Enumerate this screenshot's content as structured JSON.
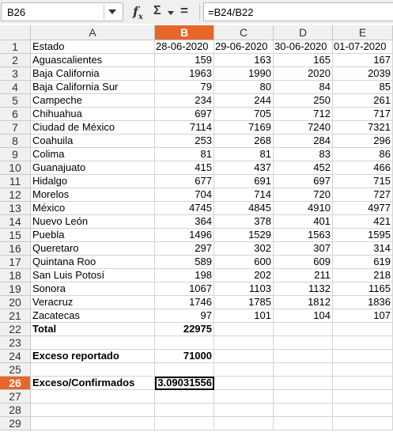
{
  "formula_bar": {
    "name_box": "B26",
    "formula": "=B24/B22"
  },
  "columns": [
    "A",
    "B",
    "C",
    "D",
    "E"
  ],
  "active_column": "B",
  "active_row": 26,
  "rows": [
    {
      "n": "1",
      "a": "Estado",
      "b": "28-06-2020",
      "c": "29-06-2020",
      "d": "30-06-2020",
      "e": "01-07-2020"
    },
    {
      "n": "2",
      "a": "Aguascalientes",
      "b": "159",
      "c": "163",
      "d": "165",
      "e": "167"
    },
    {
      "n": "3",
      "a": "Baja California",
      "b": "1963",
      "c": "1990",
      "d": "2020",
      "e": "2039"
    },
    {
      "n": "4",
      "a": "Baja California Sur",
      "b": "79",
      "c": "80",
      "d": "84",
      "e": "85"
    },
    {
      "n": "5",
      "a": "Campeche",
      "b": "234",
      "c": "244",
      "d": "250",
      "e": "261"
    },
    {
      "n": "6",
      "a": "Chihuahua",
      "b": "697",
      "c": "705",
      "d": "712",
      "e": "717"
    },
    {
      "n": "7",
      "a": "Ciudad de México",
      "b": "7114",
      "c": "7169",
      "d": "7240",
      "e": "7321"
    },
    {
      "n": "8",
      "a": "Coahuila",
      "b": "253",
      "c": "268",
      "d": "284",
      "e": "296"
    },
    {
      "n": "9",
      "a": "Colima",
      "b": "81",
      "c": "81",
      "d": "83",
      "e": "86"
    },
    {
      "n": "10",
      "a": "Guanajuato",
      "b": "415",
      "c": "437",
      "d": "452",
      "e": "466"
    },
    {
      "n": "11",
      "a": "Hidalgo",
      "b": "677",
      "c": "691",
      "d": "697",
      "e": "715"
    },
    {
      "n": "12",
      "a": "Morelos",
      "b": "704",
      "c": "714",
      "d": "720",
      "e": "727"
    },
    {
      "n": "13",
      "a": "México",
      "b": "4745",
      "c": "4845",
      "d": "4910",
      "e": "4977"
    },
    {
      "n": "14",
      "a": "Nuevo León",
      "b": "364",
      "c": "378",
      "d": "401",
      "e": "421"
    },
    {
      "n": "15",
      "a": "Puebla",
      "b": "1496",
      "c": "1529",
      "d": "1563",
      "e": "1595"
    },
    {
      "n": "16",
      "a": "Queretaro",
      "b": "297",
      "c": "302",
      "d": "307",
      "e": "314"
    },
    {
      "n": "17",
      "a": "Quintana Roo",
      "b": "589",
      "c": "600",
      "d": "609",
      "e": "619"
    },
    {
      "n": "18",
      "a": "San Luis Potosí",
      "b": "198",
      "c": "202",
      "d": "211",
      "e": "218"
    },
    {
      "n": "19",
      "a": "Sonora",
      "b": "1067",
      "c": "1103",
      "d": "1132",
      "e": "1165"
    },
    {
      "n": "20",
      "a": "Veracruz",
      "b": "1746",
      "c": "1785",
      "d": "1812",
      "e": "1836"
    },
    {
      "n": "21",
      "a": "Zacatecas",
      "b": "97",
      "c": "101",
      "d": "104",
      "e": "107"
    },
    {
      "n": "22",
      "a": "Total",
      "b": "22975",
      "c": "",
      "d": "",
      "e": ""
    },
    {
      "n": "23",
      "a": "",
      "b": "",
      "c": "",
      "d": "",
      "e": ""
    },
    {
      "n": "24",
      "a": "Exceso reportado",
      "b": "71000",
      "c": "",
      "d": "",
      "e": ""
    },
    {
      "n": "25",
      "a": "",
      "b": "",
      "c": "",
      "d": "",
      "e": ""
    },
    {
      "n": "26",
      "a": "Exceso/Confirmados",
      "b": "3.09031556",
      "c": "",
      "d": "",
      "e": ""
    },
    {
      "n": "27",
      "a": "",
      "b": "",
      "c": "",
      "d": "",
      "e": ""
    },
    {
      "n": "28",
      "a": "",
      "b": "",
      "c": "",
      "d": "",
      "e": ""
    },
    {
      "n": "29",
      "a": "",
      "b": "",
      "c": "",
      "d": "",
      "e": ""
    }
  ],
  "bold_rows": [
    "22",
    "24",
    "26"
  ]
}
